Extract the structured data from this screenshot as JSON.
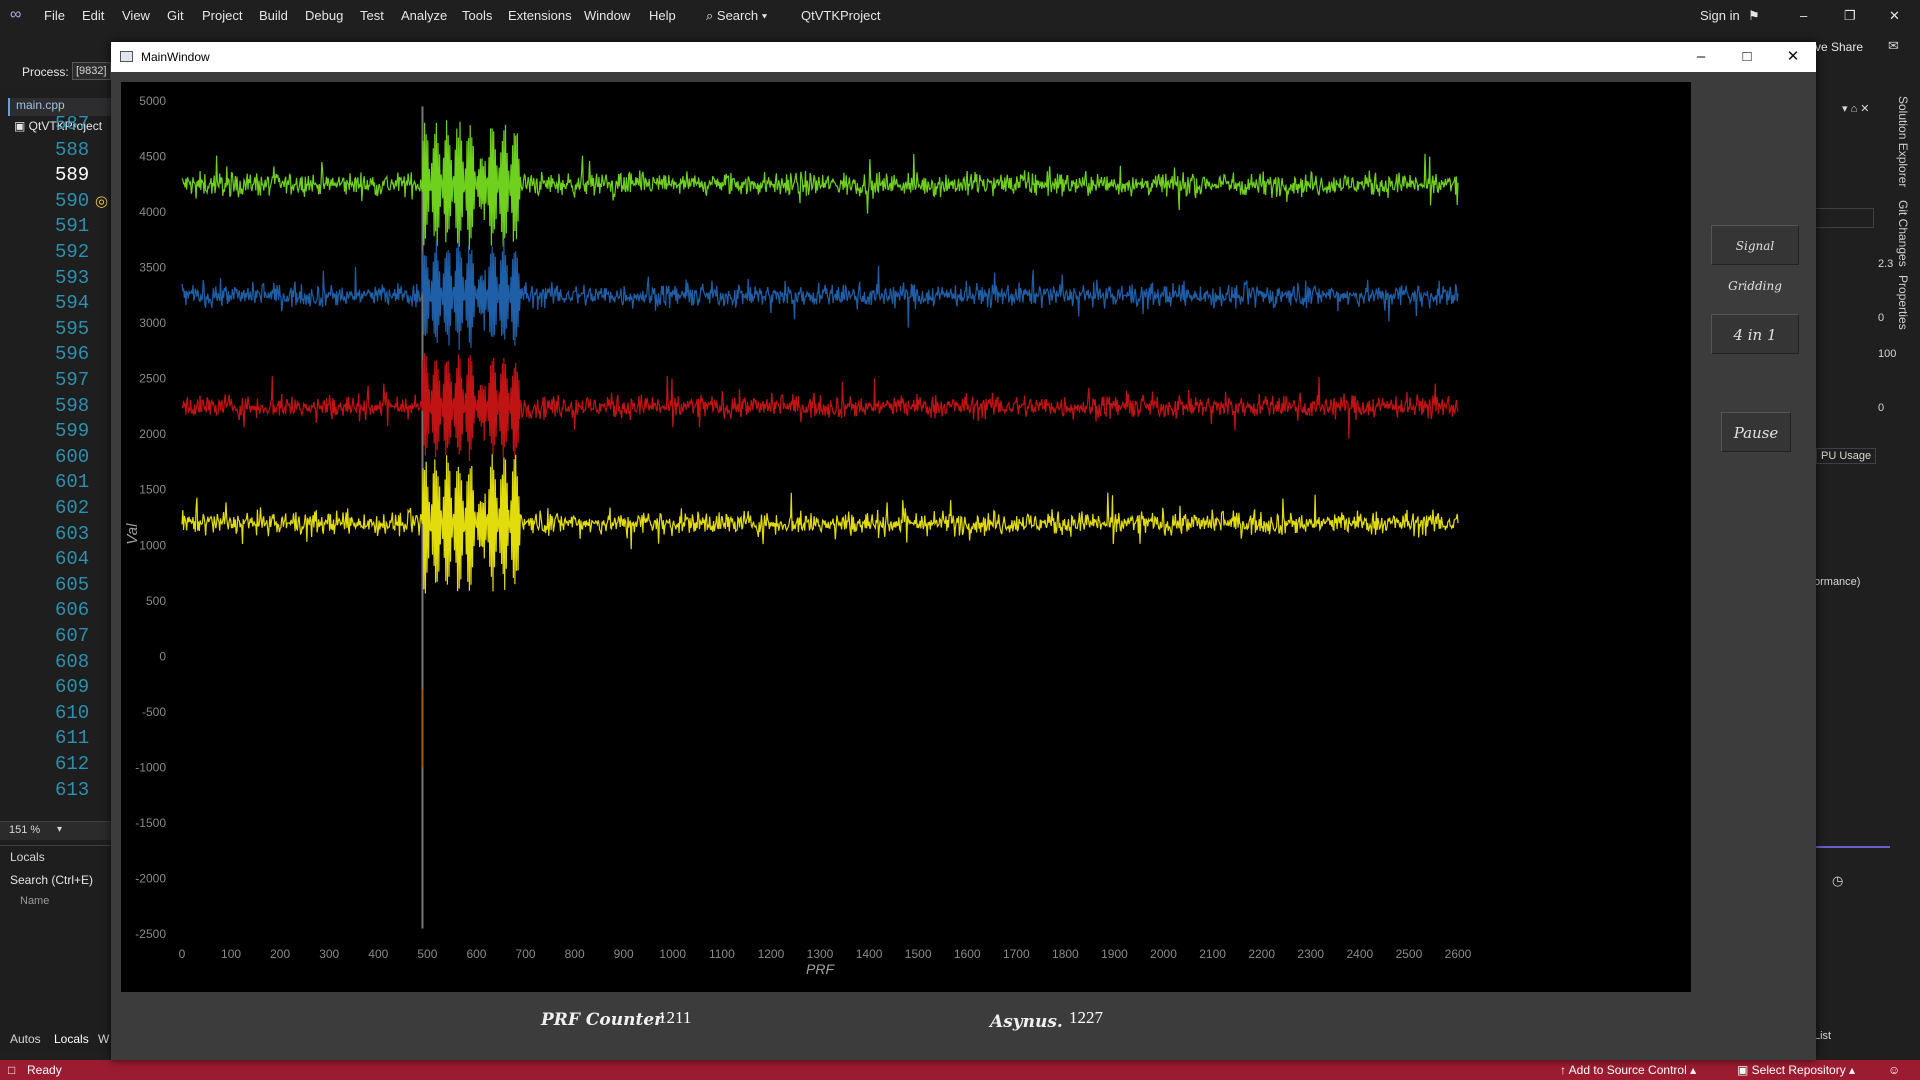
{
  "ide": {
    "menu": [
      "File",
      "Edit",
      "View",
      "Git",
      "Project",
      "Build",
      "Debug",
      "Test",
      "Analyze",
      "Tools",
      "Extensions",
      "Window",
      "Help"
    ],
    "search_label": "Search",
    "solution_name": "QtVTKProject",
    "sign_in": "Sign in",
    "live_share": "ve Share",
    "process_label": "Process:",
    "process_value": "[9832]",
    "file_tab": "main.cpp",
    "project_tab": "QtVTKProject",
    "line_numbers": [
      "587",
      "588",
      "589",
      "590",
      "591",
      "592",
      "593",
      "594",
      "595",
      "596",
      "597",
      "598",
      "599",
      "600",
      "601",
      "602",
      "603",
      "604",
      "605",
      "606",
      "607",
      "608",
      "609",
      "610",
      "611",
      "612",
      "613"
    ],
    "current_line": "589",
    "zoom": "151 %",
    "locals_title": "Locals",
    "locals_search": "Search (Ctrl+E)",
    "locals_col_name": "Name",
    "bottom_tabs": [
      "Autos",
      "Locals",
      "W"
    ],
    "right_vertical_tabs": [
      "Solution Explorer",
      "Git Changes",
      "Properties"
    ],
    "right_values": [
      "2.3",
      "0",
      "100",
      "0"
    ],
    "cpu_usage": "PU Usage",
    "performance": "ormance)",
    "list_label": "List",
    "status_ready": "Ready",
    "status_source_control": "Add to Source Control",
    "status_repo": "Select Repository",
    "accent_color": "#9b1b30"
  },
  "window": {
    "title": "MainWindow",
    "buttons": {
      "signal_gridding": "Signal Gridding",
      "four_in_one": "4 in 1",
      "pause": "Pause"
    },
    "prf_counter_label": "PRF Counter",
    "prf_counter_value": "1211",
    "asynus_label": "Asynus.",
    "asynus_value": "1227"
  },
  "chart_data": {
    "type": "line",
    "xlabel": "PRF",
    "ylabel": "Val",
    "xlim": [
      0,
      2600
    ],
    "ylim": [
      -2500,
      5000
    ],
    "xticks": [
      0,
      100,
      200,
      300,
      400,
      500,
      600,
      700,
      800,
      900,
      1000,
      1100,
      1200,
      1300,
      1400,
      1500,
      1600,
      1700,
      1800,
      1900,
      2000,
      2100,
      2200,
      2300,
      2400,
      2500,
      2600
    ],
    "yticks": [
      5000,
      4500,
      4000,
      3500,
      3000,
      2500,
      2000,
      1500,
      1000,
      500,
      0,
      -500,
      -1000,
      -1500,
      -2000,
      -2500
    ],
    "grid": false,
    "background": "#000000",
    "burst_region": [
      490,
      690
    ],
    "series": [
      {
        "color": "#6fd11e",
        "baseline": 4250,
        "noise_amplitude": 150,
        "burst_amplitude": 600,
        "x_range": [
          0,
          2600
        ]
      },
      {
        "color": "#1f5fa8",
        "baseline": 3250,
        "noise_amplitude": 150,
        "burst_amplitude": 500,
        "x_range": [
          0,
          2600
        ]
      },
      {
        "color": "#c01414",
        "baseline": 2250,
        "noise_amplitude": 150,
        "burst_amplitude": 500,
        "x_range": [
          0,
          2600
        ]
      },
      {
        "color": "#e3dc0c",
        "baseline": 1200,
        "noise_amplitude": 150,
        "burst_amplitude": 650,
        "x_range": [
          0,
          2600
        ]
      }
    ],
    "spike": {
      "x": 490,
      "min": -2450,
      "max": 4950
    }
  }
}
